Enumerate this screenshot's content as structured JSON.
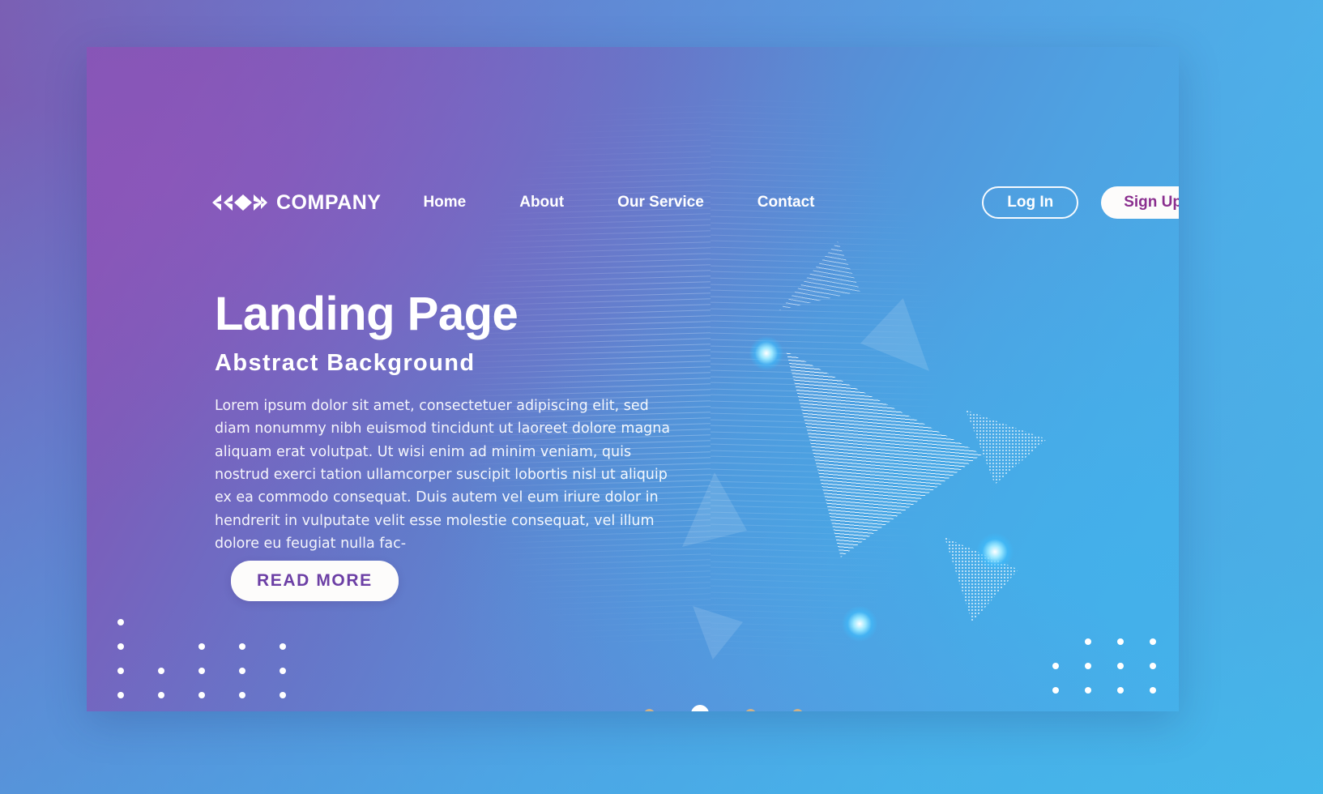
{
  "brand": {
    "name": "COMPANY",
    "logo_icon": "chevron-diamond-logo-icon"
  },
  "nav": {
    "items": [
      {
        "label": "Home"
      },
      {
        "label": "About"
      },
      {
        "label": "Our Service"
      },
      {
        "label": "Contact"
      }
    ],
    "login_label": "Log In",
    "signup_label": "Sign Up"
  },
  "hero": {
    "title": "Landing Page",
    "subtitle": "Abstract Background",
    "body": "Lorem ipsum dolor sit amet, consectetuer adipiscing elit, sed diam nonummy nibh euismod tincidunt ut laoreet dolore magna aliquam erat volutpat. Ut wisi enim ad minim veniam, quis nostrud exerci tation ullamcorper suscipit lobortis nisl ut aliquip ex ea commodo consequat. Duis autem vel eum iriure dolor in hendrerit in vulputate velit esse molestie consequat, vel illum dolore eu feugiat nulla fac-",
    "cta_label": "READ MORE"
  },
  "carousel": {
    "slides": [
      {
        "active": false
      },
      {
        "active": true
      },
      {
        "active": false
      },
      {
        "active": false
      }
    ],
    "active_index": 1
  },
  "colors": {
    "gradient_start": "#8255b4",
    "gradient_mid": "#6379c9",
    "gradient_end": "#48b0e9",
    "signup_text": "#8a2f8f",
    "cta_text": "#6c3fa5",
    "button_bg": "#fdfcfb",
    "dot_inactive": "#cdb188",
    "dot_active": "#ffffff",
    "glow": "#6fe0ff"
  }
}
